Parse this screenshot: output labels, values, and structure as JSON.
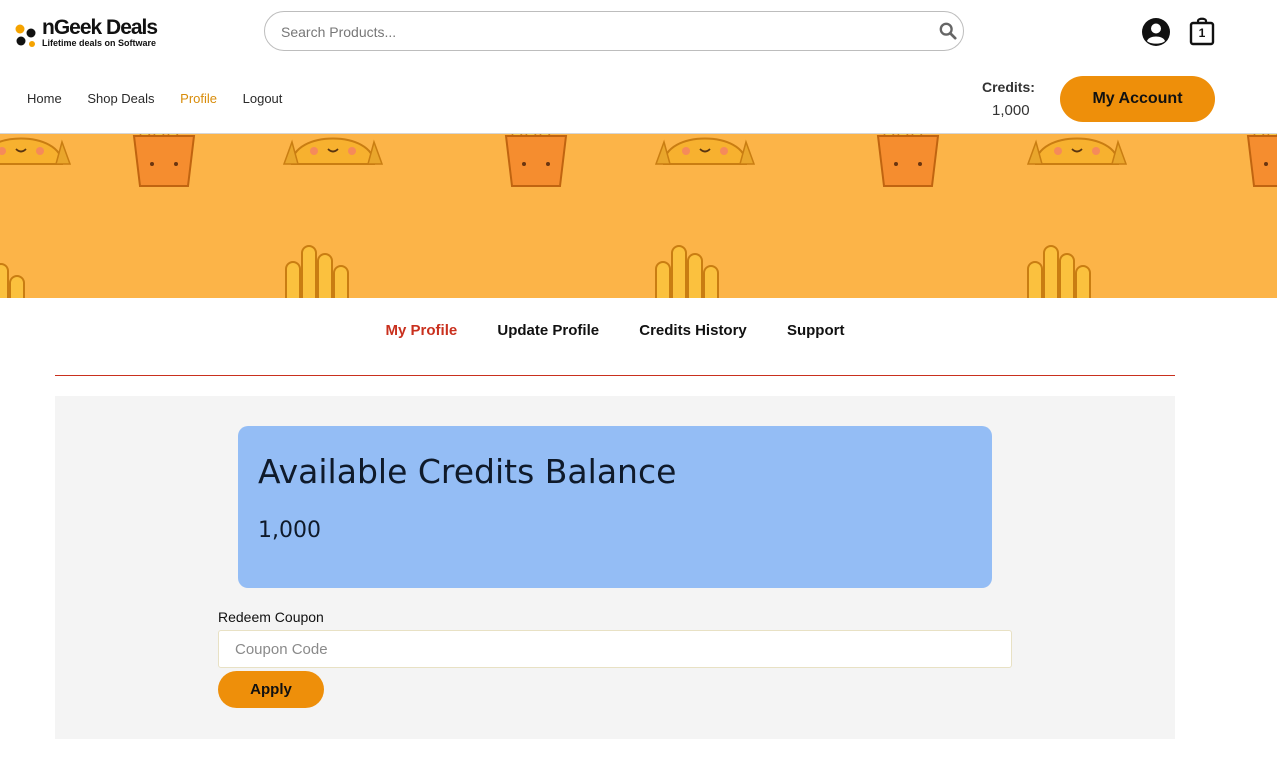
{
  "brand": {
    "name": "nGeek Deals",
    "tagline": "Lifetime deals on Software",
    "logo_icon": "molecule-dots-icon"
  },
  "search": {
    "placeholder": "Search Products..."
  },
  "header": {
    "cart_count": "1",
    "credits_label": "Credits:",
    "credits_value": "1,000",
    "my_account_label": "My Account"
  },
  "nav": {
    "items": [
      {
        "label": "Home",
        "active": false
      },
      {
        "label": "Shop Deals",
        "active": false
      },
      {
        "label": "Profile",
        "active": true
      },
      {
        "label": "Logout",
        "active": false
      }
    ]
  },
  "tabs": [
    {
      "label": "My Profile",
      "active": true
    },
    {
      "label": "Update Profile",
      "active": false
    },
    {
      "label": "Credits History",
      "active": false
    },
    {
      "label": "Support",
      "active": false
    }
  ],
  "balance_card": {
    "title": "Available Credits Balance",
    "value": "1,000"
  },
  "redeem": {
    "label": "Redeem Coupon",
    "placeholder": "Coupon Code",
    "value": "",
    "button_label": "Apply"
  },
  "colors": {
    "accent": "#ee8f0a",
    "active_nav": "#d88c0a",
    "active_tab": "#c9301e",
    "banner": "#fcb448",
    "card": "#94bdf5"
  }
}
